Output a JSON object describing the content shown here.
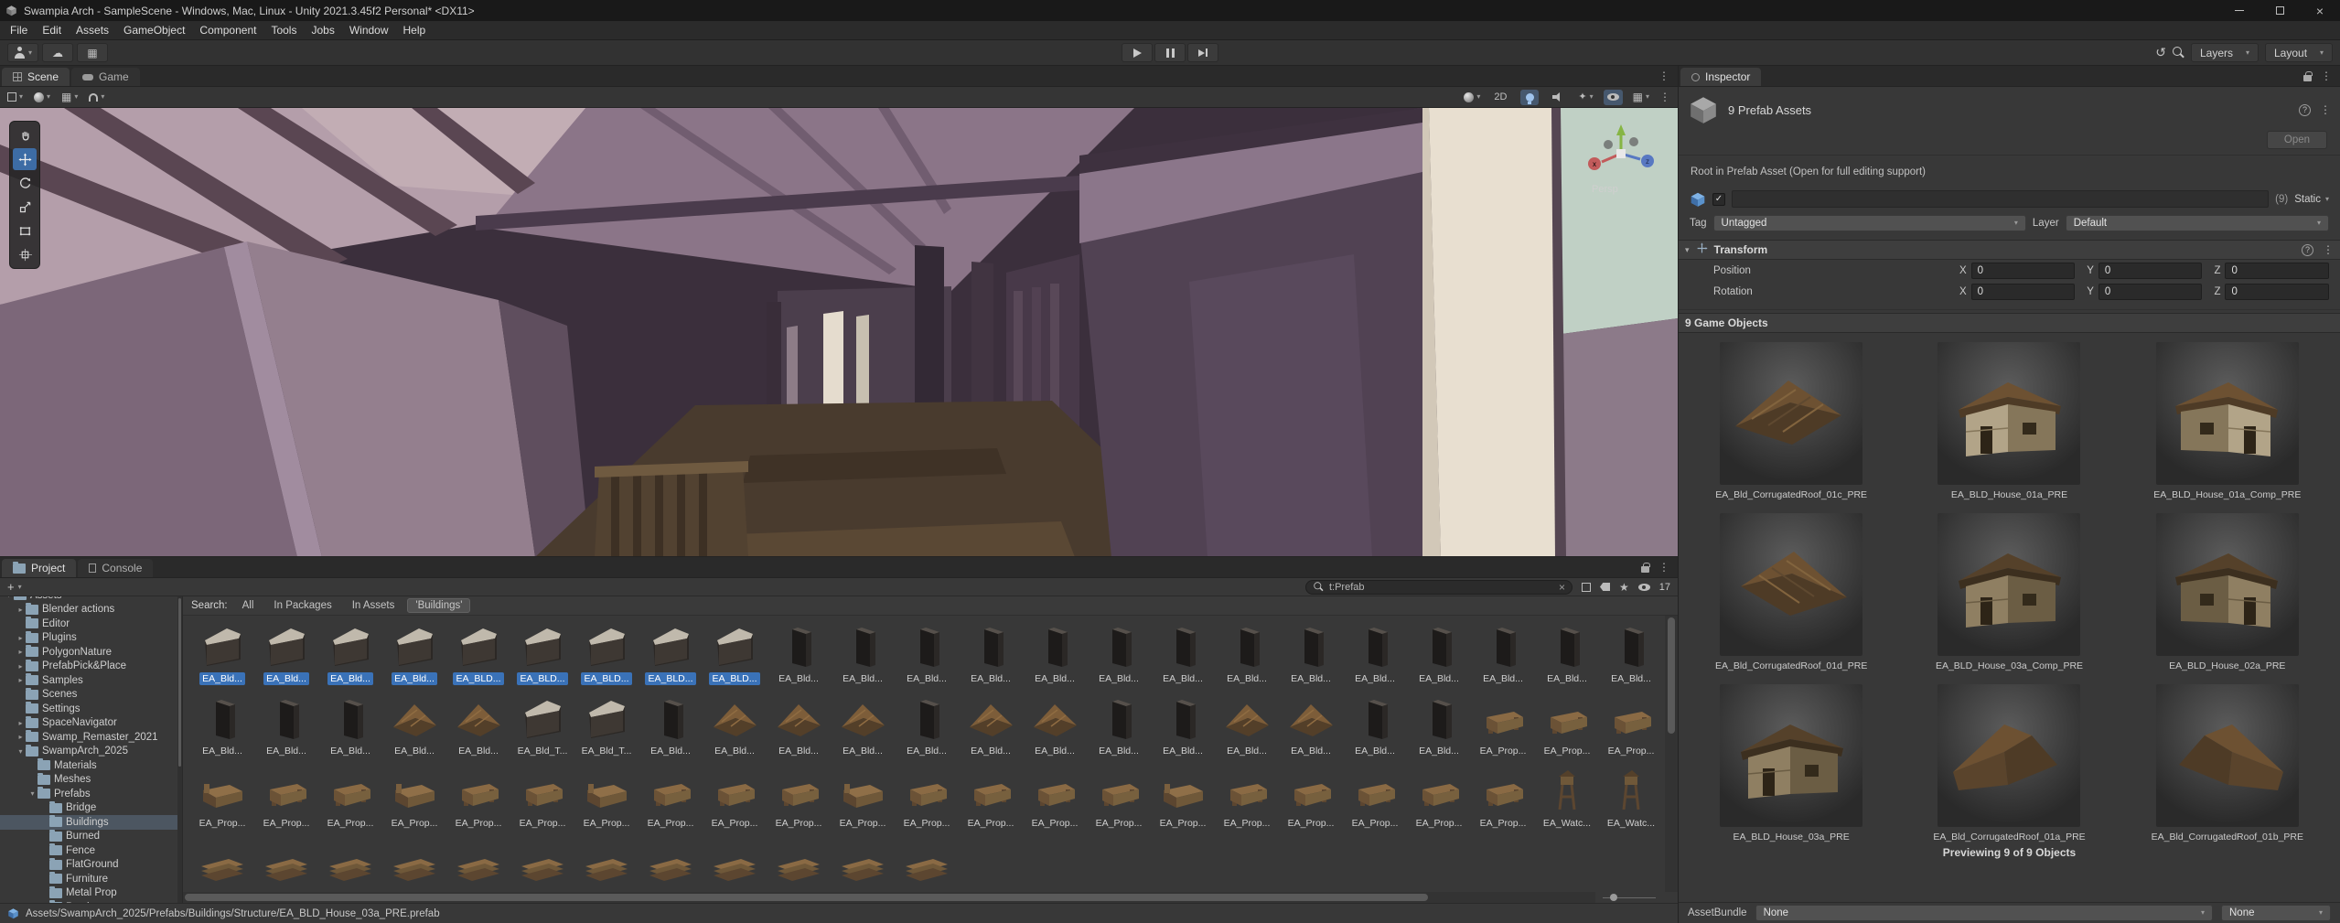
{
  "window": {
    "title": "Swampia Arch - SampleScene - Windows, Mac, Linux - Unity 2021.3.45f2 Personal* <DX11>",
    "menus": [
      "File",
      "Edit",
      "Assets",
      "GameObject",
      "Component",
      "Tools",
      "Jobs",
      "Window",
      "Help"
    ]
  },
  "icons": {
    "kebab-menu": "⋮",
    "caret-down": "▾",
    "arrow-open": "▾",
    "arrow-closed": "▸",
    "cloud": "☁",
    "grid": "▦",
    "undo-history": "↺",
    "sparkle": "✦",
    "star": "★",
    "check": "✓",
    "clear": "×",
    "plus": "+",
    "help": "?"
  },
  "toolbar": {
    "layers": "Layers",
    "layout": "Layout"
  },
  "scene": {
    "tabs": [
      {
        "label": "Scene",
        "active": true
      },
      {
        "label": "Game"
      }
    ],
    "mode_2d": "2D",
    "persp": "Persp",
    "gizmo_axes": {
      "x": "x",
      "z": "z"
    },
    "tools": [
      {
        "name": "view-tool",
        "icon": "hand"
      },
      {
        "name": "move-tool",
        "icon": "move",
        "active": true
      },
      {
        "name": "rotate-tool",
        "icon": "rotate"
      },
      {
        "name": "scale-tool",
        "icon": "scale"
      },
      {
        "name": "rect-tool",
        "icon": "rect"
      },
      {
        "name": "transform-tool",
        "icon": "transform"
      }
    ]
  },
  "project": {
    "tabs": [
      {
        "label": "Project",
        "active": true
      },
      {
        "label": "Console"
      }
    ],
    "create_button": "+",
    "search_value": "t:Prefab",
    "result_count": "17",
    "search_label": "Search:",
    "search_scopes": [
      {
        "label": "All"
      },
      {
        "label": "In Packages"
      },
      {
        "label": "In Assets"
      },
      {
        "label": "'Buildings'",
        "active": true
      }
    ],
    "folders": [
      {
        "label": "Assets",
        "depth": 0,
        "arrow": "open"
      },
      {
        "label": "Blender actions",
        "depth": 1,
        "arrow": "closed"
      },
      {
        "label": "Editor",
        "depth": 1,
        "arrow": "none"
      },
      {
        "label": "Plugins",
        "depth": 1,
        "arrow": "closed"
      },
      {
        "label": "PolygonNature",
        "depth": 1,
        "arrow": "closed"
      },
      {
        "label": "PrefabPick&Place",
        "depth": 1,
        "arrow": "closed"
      },
      {
        "label": "Samples",
        "depth": 1,
        "arrow": "closed"
      },
      {
        "label": "Scenes",
        "depth": 1,
        "arrow": "none"
      },
      {
        "label": "Settings",
        "depth": 1,
        "arrow": "none"
      },
      {
        "label": "SpaceNavigator",
        "depth": 1,
        "arrow": "closed"
      },
      {
        "label": "Swamp_Remaster_2021",
        "depth": 1,
        "arrow": "closed"
      },
      {
        "label": "SwampArch_2025",
        "depth": 1,
        "arrow": "open"
      },
      {
        "label": "Materials",
        "depth": 2,
        "arrow": "none"
      },
      {
        "label": "Meshes",
        "depth": 2,
        "arrow": "none"
      },
      {
        "label": "Prefabs",
        "depth": 2,
        "arrow": "open"
      },
      {
        "label": "Bridge",
        "depth": 3,
        "arrow": "none"
      },
      {
        "label": "Buildings",
        "depth": 3,
        "arrow": "none",
        "selected": true
      },
      {
        "label": "Burned",
        "depth": 3,
        "arrow": "none"
      },
      {
        "label": "Fence",
        "depth": 3,
        "arrow": "none"
      },
      {
        "label": "FlatGround",
        "depth": 3,
        "arrow": "none"
      },
      {
        "label": "Furniture",
        "depth": 3,
        "arrow": "none"
      },
      {
        "label": "Metal Prop",
        "depth": 3,
        "arrow": "none"
      },
      {
        "label": "Patch",
        "depth": 3,
        "arrow": "none"
      }
    ],
    "assets": {
      "rows": [
        {
          "items": [
            [
              "EA_Bld...",
              "wall",
              1
            ],
            [
              "EA_Bld...",
              "wall",
              1
            ],
            [
              "EA_Bld...",
              "wall",
              1
            ],
            [
              "EA_Bld...",
              "wall",
              1
            ],
            [
              "EA_BLD...",
              "wall",
              1
            ],
            [
              "EA_BLD...",
              "wall",
              1
            ],
            [
              "EA_BLD...",
              "wall",
              1
            ],
            [
              "EA_BLD...",
              "wall",
              1
            ],
            [
              "EA_BLD...",
              "wall",
              1
            ],
            [
              "EA_Bld...",
              "panel",
              0
            ],
            [
              "EA_Bld...",
              "panel",
              0
            ],
            [
              "EA_Bld...",
              "panel",
              0
            ],
            [
              "EA_Bld...",
              "panel",
              0
            ],
            [
              "EA_Bld...",
              "panel",
              0
            ],
            [
              "EA_Bld...",
              "panel",
              0
            ],
            [
              "EA_Bld...",
              "panel",
              0
            ],
            [
              "EA_Bld...",
              "panel",
              0
            ],
            [
              "EA_Bld...",
              "panel",
              0
            ],
            [
              "EA_Bld...",
              "panel",
              0
            ],
            [
              "EA_Bld...",
              "panel",
              0
            ],
            [
              "EA_Bld...",
              "panel",
              0
            ],
            [
              "EA_Bld...",
              "panel",
              0
            ],
            [
              "EA_Bld...",
              "panel",
              0
            ]
          ]
        },
        {
          "items": [
            [
              "EA_Bld...",
              "panel",
              0
            ],
            [
              "EA_Bld...",
              "panel",
              0
            ],
            [
              "EA_Bld...",
              "panel",
              0
            ],
            [
              "EA_Bld...",
              "roof",
              0
            ],
            [
              "EA_Bld...",
              "roof",
              0
            ],
            [
              "EA_Bld_T...",
              "wall",
              0
            ],
            [
              "EA_Bld_T...",
              "wall",
              0
            ],
            [
              "EA_Bld...",
              "panel",
              0
            ],
            [
              "EA_Bld...",
              "roof",
              0
            ],
            [
              "EA_Bld...",
              "roof",
              0
            ],
            [
              "EA_Bld...",
              "roof",
              0
            ],
            [
              "EA_Bld...",
              "panel",
              0
            ],
            [
              "EA_Bld...",
              "roof",
              0
            ],
            [
              "EA_Bld...",
              "roof",
              0
            ],
            [
              "EA_Bld...",
              "panel",
              0
            ],
            [
              "EA_Bld...",
              "panel",
              0
            ],
            [
              "EA_Bld...",
              "roof",
              0
            ],
            [
              "EA_Bld...",
              "roof",
              0
            ],
            [
              "EA_Bld...",
              "panel",
              0
            ],
            [
              "EA_Bld...",
              "panel",
              0
            ],
            [
              "EA_Prop...",
              "prop",
              0
            ],
            [
              "EA_Prop...",
              "prop",
              0
            ],
            [
              "EA_Prop...",
              "prop",
              0
            ]
          ]
        },
        {
          "items": [
            [
              "EA_Prop...",
              "bed",
              0
            ],
            [
              "EA_Prop...",
              "prop",
              0
            ],
            [
              "EA_Prop...",
              "prop",
              0
            ],
            [
              "EA_Prop...",
              "bed",
              0
            ],
            [
              "EA_Prop...",
              "prop",
              0
            ],
            [
              "EA_Prop...",
              "prop",
              0
            ],
            [
              "EA_Prop...",
              "bed",
              0
            ],
            [
              "EA_Prop...",
              "prop",
              0
            ],
            [
              "EA_Prop...",
              "prop",
              0
            ],
            [
              "EA_Prop...",
              "prop",
              0
            ],
            [
              "EA_Prop...",
              "bed",
              0
            ],
            [
              "EA_Prop...",
              "prop",
              0
            ],
            [
              "EA_Prop...",
              "prop",
              0
            ],
            [
              "EA_Prop...",
              "prop",
              0
            ],
            [
              "EA_Prop...",
              "prop",
              0
            ],
            [
              "EA_Prop...",
              "bed",
              0
            ],
            [
              "EA_Prop...",
              "prop",
              0
            ],
            [
              "EA_Prop...",
              "prop",
              0
            ],
            [
              "EA_Prop...",
              "prop",
              0
            ],
            [
              "EA_Prop...",
              "prop",
              0
            ],
            [
              "EA_Prop...",
              "prop",
              0
            ],
            [
              "EA_Watc...",
              "tower",
              0
            ],
            [
              "EA_Watc...",
              "tower",
              0
            ]
          ]
        },
        {
          "items": [
            [
              "",
              "pallet",
              0
            ],
            [
              "",
              "pallet",
              0
            ],
            [
              "",
              "pallet",
              0
            ],
            [
              "",
              "pallet",
              0
            ],
            [
              "",
              "pallet",
              0
            ],
            [
              "",
              "pallet",
              0
            ],
            [
              "",
              "pallet",
              0
            ],
            [
              "",
              "pallet",
              0
            ],
            [
              "",
              "pallet",
              0
            ],
            [
              "",
              "pallet",
              0
            ],
            [
              "",
              "pallet",
              0
            ],
            [
              "",
              "pallet",
              0
            ]
          ]
        }
      ]
    },
    "status_path": "Assets/SwampArch_2025/Prefabs/Buildings/Structure/EA_BLD_House_03a_PRE.prefab"
  },
  "inspector": {
    "tab_label": "Inspector",
    "header": "9 Prefab Assets",
    "open_button": "Open",
    "note": "Root in Prefab Asset (Open for full editing support)",
    "name_value": "",
    "count_badge": "(9)",
    "static_label": "Static",
    "tag_label": "Tag",
    "tag_value": "Untagged",
    "layer_label": "Layer",
    "layer_value": "Default",
    "transform": {
      "title": "Transform",
      "axis_labels": [
        "X",
        "Y",
        "Z"
      ],
      "rows": [
        {
          "label": "Position",
          "values": [
            "0",
            "0",
            "0"
          ]
        },
        {
          "label": "Rotation",
          "values": [
            "0",
            "0",
            "0"
          ]
        }
      ]
    },
    "game_objects_header": "9 Game Objects",
    "previews": [
      {
        "name": "EA_Bld_CorrugatedRoof_01c_PRE",
        "kind": "roof",
        "variant": 0
      },
      {
        "name": "EA_BLD_House_01a_PRE",
        "kind": "house",
        "variant": 0
      },
      {
        "name": "EA_BLD_House_01a_Comp_PRE",
        "kind": "house",
        "variant": 1
      },
      {
        "name": "EA_Bld_CorrugatedRoof_01d_PRE",
        "kind": "roof",
        "variant": 1
      },
      {
        "name": "EA_BLD_House_03a_Comp_PRE",
        "kind": "house",
        "variant": 2
      },
      {
        "name": "EA_BLD_House_02a_PRE",
        "kind": "house",
        "variant": 3
      },
      {
        "name": "EA_BLD_House_03a_PRE",
        "kind": "house",
        "variant": 2
      },
      {
        "name": "EA_Bld_CorrugatedRoof_01a_PRE",
        "kind": "roof",
        "variant": 2
      },
      {
        "name": "EA_Bld_CorrugatedRoof_01b_PRE",
        "kind": "roof",
        "variant": 3
      }
    ],
    "previewing_label": "Previewing 9 of 9 Objects",
    "assetbundle_label": "AssetBundle",
    "assetbundle_value": "None",
    "assetbundle_variant": "None"
  }
}
